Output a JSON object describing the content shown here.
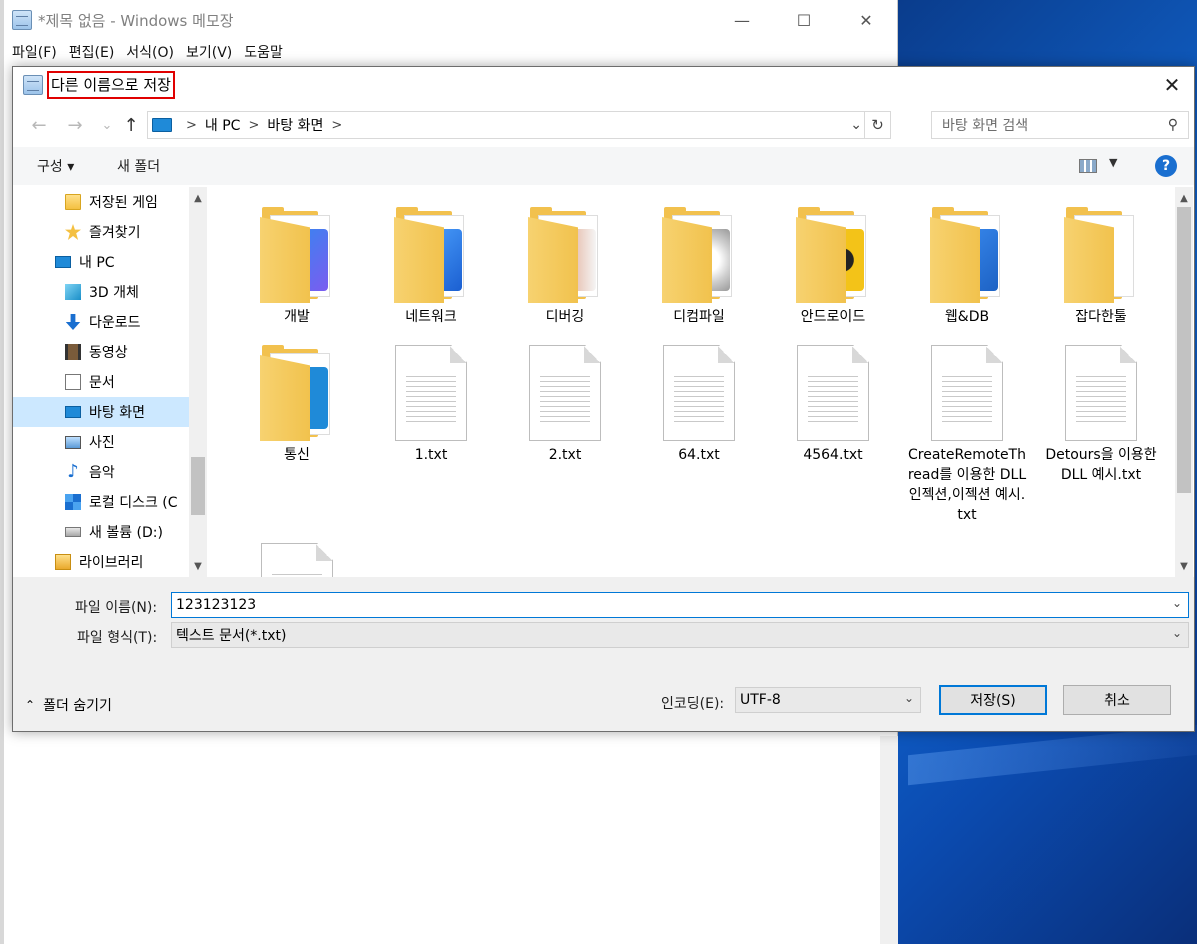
{
  "notepad": {
    "title": "*제목 없음 - Windows 메모장",
    "menu": [
      "파일(F)",
      "편집(E)",
      "서식(O)",
      "보기(V)",
      "도움말"
    ],
    "controls": {
      "minimize": "—",
      "maximize": "☐",
      "close": "✕"
    }
  },
  "dialog": {
    "title": "다른 이름으로 저장",
    "close": "✕",
    "nav": {
      "back": "←",
      "forward": "→",
      "recent": "⌄",
      "up": "↑"
    },
    "address": {
      "crumbs": [
        "내 PC",
        "바탕 화면"
      ],
      "sep": ">"
    },
    "search": {
      "placeholder": "바탕 화면 검색",
      "icon": "search-icon"
    },
    "commands": {
      "organize": "구성 ▾",
      "new_folder": "새 폴더",
      "help": "?"
    },
    "tree": [
      {
        "label": "저장된 게임",
        "icon": "saved-games-icon"
      },
      {
        "label": "즐겨찾기",
        "icon": "star-icon"
      },
      {
        "label": "내 PC",
        "icon": "pc-icon"
      },
      {
        "label": "3D 개체",
        "icon": "3d-objects-icon"
      },
      {
        "label": "다운로드",
        "icon": "download-icon"
      },
      {
        "label": "동영상",
        "icon": "video-icon"
      },
      {
        "label": "문서",
        "icon": "document-icon"
      },
      {
        "label": "바탕 화면",
        "icon": "desktop-icon",
        "selected": true
      },
      {
        "label": "사진",
        "icon": "pictures-icon"
      },
      {
        "label": "음악",
        "icon": "music-icon"
      },
      {
        "label": "로컬 디스크 (C",
        "icon": "local-disk-icon"
      },
      {
        "label": "새 볼륨 (D:)",
        "icon": "drive-icon"
      },
      {
        "label": "라이브러리",
        "icon": "library-icon"
      }
    ],
    "files": [
      {
        "name": "개발",
        "type": "folder",
        "badge_color": "#7b5cf0"
      },
      {
        "name": "네트워크",
        "type": "folder",
        "badge_color": "#1b5fd1"
      },
      {
        "name": "디버깅",
        "type": "folder",
        "badge_color": "#d88a6a"
      },
      {
        "name": "디컴파일",
        "type": "folder",
        "badge_color": "#cfcfcf"
      },
      {
        "name": "안드로이드",
        "type": "folder",
        "badge_color": "#f3c318"
      },
      {
        "name": "웹&DB",
        "type": "folder",
        "badge_color": "#1d62c4"
      },
      {
        "name": "잡다한툴",
        "type": "folder",
        "badge_color": "#ffffff"
      },
      {
        "name": "통신",
        "type": "folder",
        "badge_color": "#1f8ad8"
      },
      {
        "name": "1.txt",
        "type": "txt"
      },
      {
        "name": "2.txt",
        "type": "txt"
      },
      {
        "name": "64.txt",
        "type": "txt"
      },
      {
        "name": "4564.txt",
        "type": "txt"
      },
      {
        "name": "CreateRemoteThread를 이용한 DLL 인젝션,이젝션 예시.txt",
        "type": "txt"
      },
      {
        "name": "Detours을 이용한 DLL 예시.txt",
        "type": "txt"
      }
    ],
    "filename": {
      "label": "파일 이름(N):",
      "value": "123123123"
    },
    "filetype": {
      "label": "파일 형식(T):",
      "value": "텍스트 문서(*.txt)"
    },
    "encoding": {
      "label": "인코딩(E):",
      "value": "UTF-8"
    },
    "save_label": "저장(S)",
    "cancel_label": "취소",
    "hide_folders_label": "폴더 숨기기"
  }
}
